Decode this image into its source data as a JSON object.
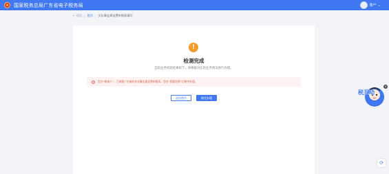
{
  "header": {
    "title": "国家税务总局广东省电子税务局",
    "user_name": "陈**"
  },
  "breadcrumb": {
    "back": "← 返回",
    "home": "首页",
    "current": "文化事业建设费申报表填写"
  },
  "result": {
    "title": "检测完成",
    "subtitle": "当前业务校验结果如下，请根据对应的业务情况进行办理。",
    "notice": "您为“微电人”，已申报广东省的文化事业建设费申报表，您在“我要办税”功能中处理。"
  },
  "buttons": {
    "back_home": "返回首页",
    "go_handle": "前往办理"
  },
  "mascot": {
    "text": "税互动"
  },
  "colors": {
    "brand": "#3f78f2",
    "warning": "#f39c2c",
    "notice_text": "#d9604d",
    "notice_bg": "#fdf3f2"
  }
}
